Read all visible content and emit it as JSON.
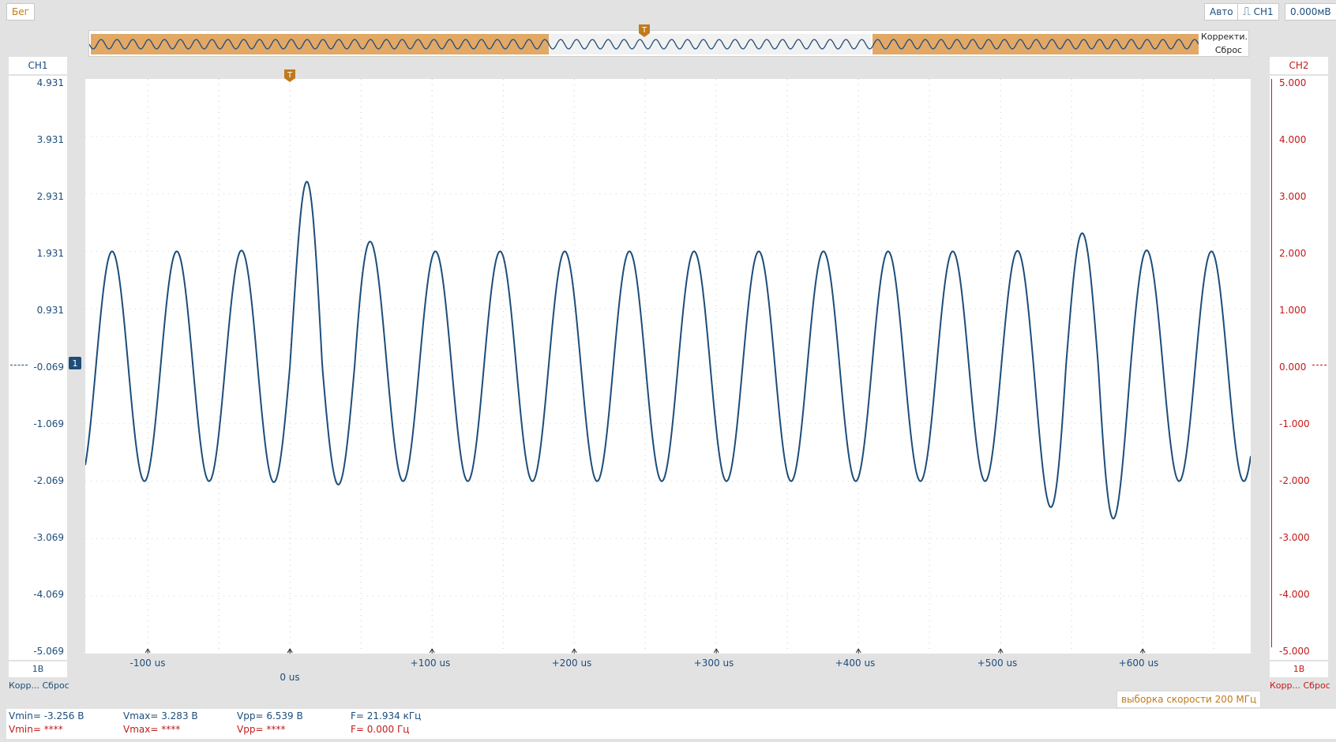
{
  "toolbar": {
    "status": "Бег",
    "mode": "Авто",
    "trigger_source": "CH1",
    "trigger_level": "0.000мВ"
  },
  "overview": {
    "correction_label": "Корректи...",
    "reset_label": "Сброс"
  },
  "ch1": {
    "name": "CH1",
    "scale": "1В",
    "correction_label": "Корр...",
    "reset_label": "Сброс",
    "y_ticks": [
      "4.931",
      "3.931",
      "2.931",
      "1.931",
      "0.931",
      "-0.069",
      "-1.069",
      "-2.069",
      "-3.069",
      "-4.069",
      "-5.069"
    ]
  },
  "ch2": {
    "name": "CH2",
    "scale": "1В",
    "correction_label": "Корр...",
    "reset_label": "Сброс",
    "y_ticks": [
      "5.000",
      "4.000",
      "3.000",
      "2.000",
      "1.000",
      "0.000",
      "-1.000",
      "-2.000",
      "-3.000",
      "-4.000",
      "-5.000"
    ]
  },
  "trigger_marker": "T",
  "ground_marker": "1",
  "x_axis": {
    "labels": [
      "-100 us",
      "+100 us",
      "+200 us",
      "+300 us",
      "+400 us",
      "+500 us",
      "+600 us"
    ],
    "zero_label": "0 us"
  },
  "sample_rate": "выборка скорости 200 МГц",
  "measurements": {
    "ch1": {
      "vmin": "Vmin= -3.256 В",
      "vmax": "Vmax= 3.283 В",
      "vpp": "Vpp= 6.539 В",
      "freq": "F= 21.934 кГц"
    },
    "ch2": {
      "vmin": "Vmin= ****",
      "vmax": "Vmax= ****",
      "vpp": "Vpp= ****",
      "freq": "F= 0.000 Гц"
    }
  },
  "colors": {
    "ch1": "#1d4d7a",
    "ch2": "#c21a1a",
    "accent": "#c07a1e",
    "overview_shade": "#e1a866"
  },
  "chart_data": {
    "type": "line",
    "xlabel": "",
    "ylabel": "",
    "x_unit": "us",
    "xlim": [
      -144,
      676
    ],
    "ylim": [
      -5.069,
      4.931
    ],
    "grid": true,
    "series": [
      {
        "name": "CH1",
        "base_amplitude": 2.0,
        "offset": -0.069,
        "period_us": 45.5,
        "glitches": [
          {
            "center_us": 20,
            "peak": 3.283,
            "min": -2.15
          },
          {
            "center_us": 560,
            "peak": 2.25,
            "min": -3.256
          }
        ]
      }
    ]
  }
}
